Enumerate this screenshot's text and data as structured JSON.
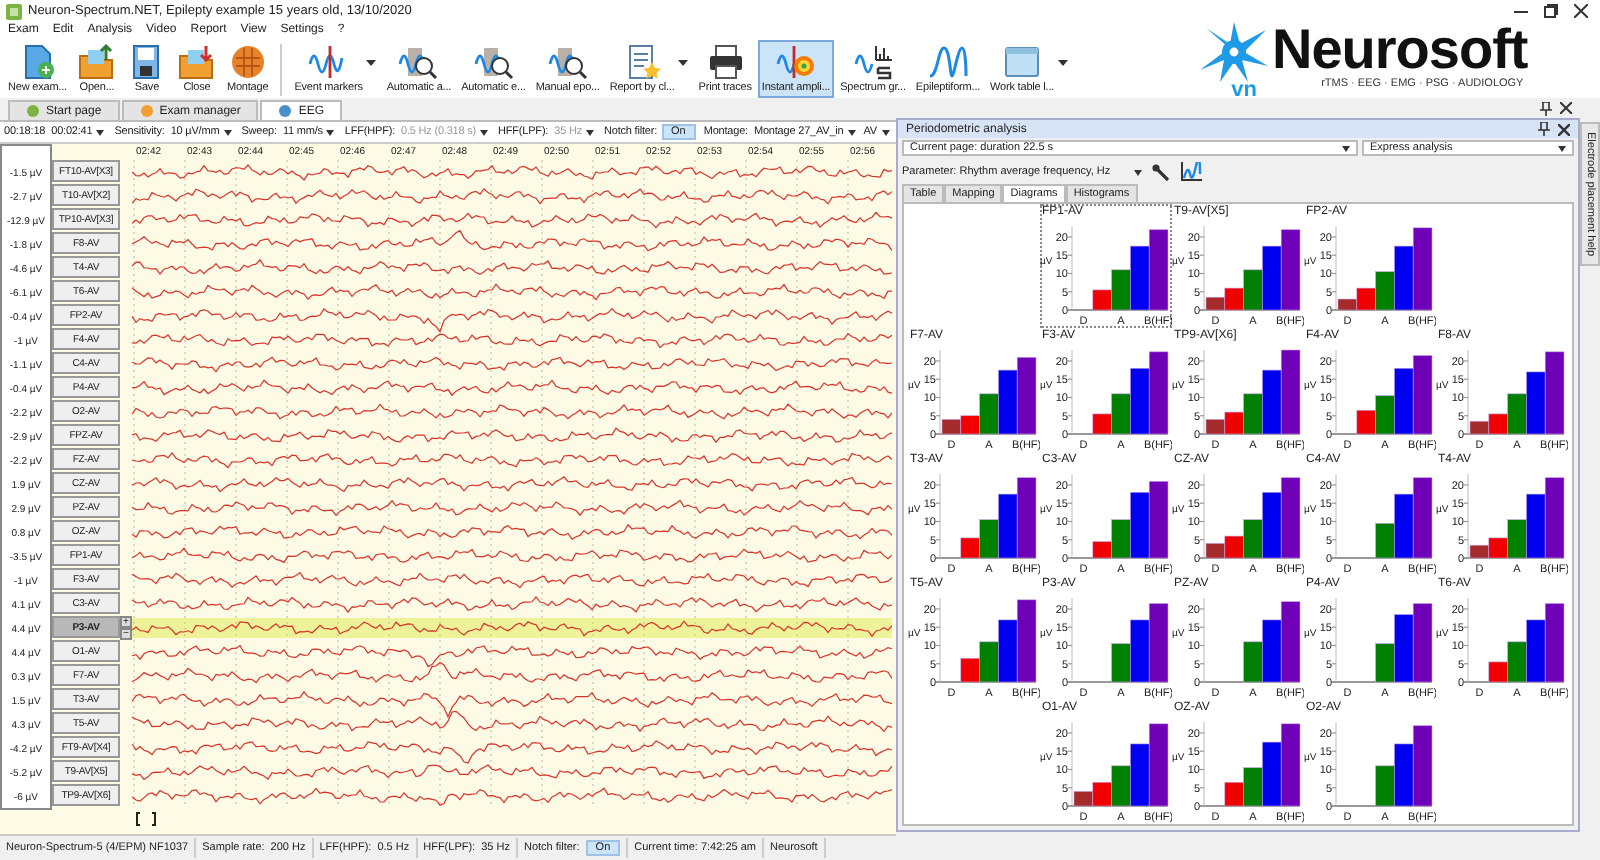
{
  "window": {
    "title": "Neuron-Spectrum.NET, Epilepty example 15 years old, 13/10/2020"
  },
  "menu": [
    "Exam",
    "Edit",
    "Analysis",
    "Video",
    "Report",
    "View",
    "Settings",
    "?"
  ],
  "toolbar": {
    "groups": [
      [
        {
          "label": "New exam...",
          "selected": false,
          "dropdown": false
        },
        {
          "label": "Open...",
          "selected": false,
          "dropdown": false
        },
        {
          "label": "Save",
          "selected": false,
          "dropdown": false
        },
        {
          "label": "Close",
          "selected": false,
          "dropdown": false
        },
        {
          "label": "Montage",
          "selected": false,
          "dropdown": false
        }
      ],
      [
        {
          "label": "Event markers",
          "selected": false,
          "dropdown": true
        },
        {
          "label": "Automatic a...",
          "selected": false,
          "dropdown": false
        },
        {
          "label": "Automatic e...",
          "selected": false,
          "dropdown": false
        },
        {
          "label": "Manual epo...",
          "selected": false,
          "dropdown": false
        },
        {
          "label": "Report by cl...",
          "selected": false,
          "dropdown": true
        },
        {
          "label": "Print traces",
          "selected": false,
          "dropdown": false
        },
        {
          "label": "Instant ampli...",
          "selected": true,
          "dropdown": false
        },
        {
          "label": "Spectrum gr...",
          "selected": false,
          "dropdown": false
        },
        {
          "label": "Epileptiform...",
          "selected": false,
          "dropdown": false
        },
        {
          "label": "Work table l...",
          "selected": false,
          "dropdown": true
        }
      ]
    ]
  },
  "logo": {
    "name": "Neurosoft",
    "suffix": "vn",
    "tagline": "rTMS · EEG · EMG · PSG · AUDIOLOGY"
  },
  "tabs": [
    {
      "label": "Start page",
      "selected": false
    },
    {
      "label": "Exam manager",
      "selected": false
    },
    {
      "label": "EEG",
      "selected": true
    }
  ],
  "eeg": {
    "params": [
      {
        "kind": "text",
        "value": "00:18:18"
      },
      {
        "kind": "dropdown",
        "value": "00:02:41",
        "disabled": false
      },
      {
        "kind": "dropdown",
        "label": "Sensitivity:",
        "value": "10 µV/mm",
        "disabled": false
      },
      {
        "kind": "dropdown",
        "label": "Sweep:",
        "value": "11 mm/s",
        "disabled": false
      },
      {
        "kind": "dropdown",
        "label": "LFF(HPF):",
        "value": "0.5 Hz (0.318 s)",
        "disabled": true
      },
      {
        "kind": "dropdown",
        "label": "HFF(LPF):",
        "value": "35 Hz",
        "disabled": true
      },
      {
        "kind": "toggle",
        "label": "Notch filter:",
        "value": "On",
        "on": true
      },
      {
        "kind": "dropdown",
        "label": "Montage:",
        "value": "Montage 27_AV_in",
        "disabled": false
      },
      {
        "kind": "dropdown",
        "value": "AV",
        "disabled": false
      }
    ],
    "times": [
      "02:42",
      "02:43",
      "02:44",
      "02:45",
      "02:46",
      "02:47",
      "02:48",
      "02:49",
      "02:50",
      "02:51",
      "02:52",
      "02:53",
      "02:54",
      "02:55",
      "02:56"
    ],
    "adjust_buttons": [
      "+",
      "−"
    ],
    "channels": [
      {
        "name": "FT10-AV[X3]",
        "reading": "-1.5 µV",
        "selected": false
      },
      {
        "name": "T10-AV[X2]",
        "reading": "-2.7 µV",
        "selected": false
      },
      {
        "name": "TP10-AV[X3]",
        "reading": "-12.9 µV",
        "selected": false
      },
      {
        "name": "F8-AV",
        "reading": "-1.8 µV",
        "selected": false
      },
      {
        "name": "T4-AV",
        "reading": "-4.6 µV",
        "selected": false
      },
      {
        "name": "T6-AV",
        "reading": "-6.1 µV",
        "selected": false
      },
      {
        "name": "FP2-AV",
        "reading": "-0.4 µV",
        "selected": false
      },
      {
        "name": "F4-AV",
        "reading": "-1 µV",
        "selected": false
      },
      {
        "name": "C4-AV",
        "reading": "-1.1 µV",
        "selected": false
      },
      {
        "name": "P4-AV",
        "reading": "-0.4 µV",
        "selected": false
      },
      {
        "name": "O2-AV",
        "reading": "-2.2 µV",
        "selected": false
      },
      {
        "name": "FPZ-AV",
        "reading": "-2.9 µV",
        "selected": false
      },
      {
        "name": "FZ-AV",
        "reading": "-2.2 µV",
        "selected": false
      },
      {
        "name": "CZ-AV",
        "reading": "1.9 µV",
        "selected": false
      },
      {
        "name": "PZ-AV",
        "reading": "2.9 µV",
        "selected": false
      },
      {
        "name": "OZ-AV",
        "reading": "0.8 µV",
        "selected": false
      },
      {
        "name": "FP1-AV",
        "reading": "-3.5 µV",
        "selected": false
      },
      {
        "name": "F3-AV",
        "reading": "-1 µV",
        "selected": false
      },
      {
        "name": "C3-AV",
        "reading": "4.1 µV",
        "selected": false
      },
      {
        "name": "P3-AV",
        "reading": "4.4 µV",
        "selected": true
      },
      {
        "name": "O1-AV",
        "reading": "4.4 µV",
        "selected": false
      },
      {
        "name": "F7-AV",
        "reading": "0.3 µV",
        "selected": false
      },
      {
        "name": "T3-AV",
        "reading": "1.5 µV",
        "selected": false
      },
      {
        "name": "T5-AV",
        "reading": "4.3 µV",
        "selected": false
      },
      {
        "name": "FT9-AV[X4]",
        "reading": "-4.2 µV",
        "selected": false
      },
      {
        "name": "T9-AV[X5]",
        "reading": "-5.2 µV",
        "selected": false
      },
      {
        "name": "TP9-AV[X6]",
        "reading": "-6 µV",
        "selected": false
      }
    ]
  },
  "status_bar": [
    {
      "kind": "text",
      "value": "Neuron-Spectrum-5 (4/EPM) NF1037"
    },
    {
      "kind": "text",
      "label": "Sample rate:",
      "value": "200 Hz"
    },
    {
      "kind": "text",
      "label": "LFF(HPF):",
      "value": "0.5 Hz"
    },
    {
      "kind": "text",
      "label": "HFF(LPF):",
      "value": "35 Hz"
    },
    {
      "kind": "toggle",
      "label": "Notch filter:",
      "value": "On",
      "on": true
    },
    {
      "kind": "text",
      "value": "Current time: 7:42:25 am"
    },
    {
      "kind": "text",
      "value": "Neurosoft"
    }
  ],
  "panel": {
    "title": "Periodometric analysis",
    "page_select": "Current page: duration 22.5 s",
    "mode_select": "Express analysis",
    "parameter": "Parameter: Rhythm average frequency, Hz",
    "tabs": [
      {
        "label": "Table",
        "selected": false
      },
      {
        "label": "Mapping",
        "selected": false
      },
      {
        "label": "Diagrams",
        "selected": true
      },
      {
        "label": "Histograms",
        "selected": false
      }
    ],
    "diagrams": {
      "rows": [
        [
          {
            "selected": true,
            "chart_data": {
              "type": "bar",
              "title": "FP1-AV",
              "ylabel": "µV",
              "categories": [
                "D",
                null,
                "A",
                null,
                "B(HF)"
              ],
              "values": [
                0,
                5.5,
                11,
                17.5,
                22
              ],
              "yticks": [
                0,
                5,
                10,
                15,
                20
              ],
              "ylim": [
                0,
                23
              ]
            }
          },
          {
            "selected": false,
            "chart_data": {
              "type": "bar",
              "title": "T9-AV[X5]",
              "ylabel": "µV",
              "categories": [
                "D",
                null,
                "A",
                null,
                "B(HF)"
              ],
              "values": [
                3.5,
                6,
                11,
                17.5,
                22
              ],
              "yticks": [
                0,
                5,
                10,
                15,
                20
              ],
              "ylim": [
                0,
                23
              ]
            }
          },
          {
            "selected": false,
            "chart_data": {
              "type": "bar",
              "title": "FP2-AV",
              "ylabel": "µV",
              "categories": [
                "D",
                null,
                "A",
                null,
                "B(HF)"
              ],
              "values": [
                3,
                6,
                10.5,
                17.5,
                22.5
              ],
              "yticks": [
                0,
                5,
                10,
                15,
                20
              ],
              "ylim": [
                0,
                23
              ]
            }
          }
        ],
        [
          {
            "selected": false,
            "chart_data": {
              "type": "bar",
              "title": "F7-AV",
              "ylabel": "µV",
              "categories": [
                "D",
                null,
                "A",
                null,
                "B(HF)"
              ],
              "values": [
                4,
                5,
                11,
                17.5,
                21
              ],
              "yticks": [
                0,
                5,
                10,
                15,
                20
              ],
              "ylim": [
                0,
                23
              ]
            }
          },
          {
            "selected": false,
            "chart_data": {
              "type": "bar",
              "title": "F3-AV",
              "ylabel": "µV",
              "categories": [
                "D",
                null,
                "A",
                null,
                "B(HF)"
              ],
              "values": [
                0,
                5.5,
                11,
                18,
                22.5
              ],
              "yticks": [
                0,
                5,
                10,
                15,
                20
              ],
              "ylim": [
                0,
                23
              ]
            }
          },
          {
            "selected": false,
            "chart_data": {
              "type": "bar",
              "title": "TP9-AV[X6]",
              "ylabel": "µV",
              "categories": [
                "D",
                null,
                "A",
                null,
                "B(HF)"
              ],
              "values": [
                4,
                6,
                11,
                17.5,
                23
              ],
              "yticks": [
                0,
                5,
                10,
                15,
                20
              ],
              "ylim": [
                0,
                23
              ]
            }
          },
          {
            "selected": false,
            "chart_data": {
              "type": "bar",
              "title": "F4-AV",
              "ylabel": "µV",
              "categories": [
                "D",
                null,
                "A",
                null,
                "B(HF)"
              ],
              "values": [
                0,
                6.5,
                10.5,
                18,
                21.5
              ],
              "yticks": [
                0,
                5,
                10,
                15,
                20
              ],
              "ylim": [
                0,
                23
              ]
            }
          },
          {
            "selected": false,
            "chart_data": {
              "type": "bar",
              "title": "F8-AV",
              "ylabel": "µV",
              "categories": [
                "D",
                null,
                "A",
                null,
                "B(HF)"
              ],
              "values": [
                3.5,
                5.5,
                11,
                17,
                22.5
              ],
              "yticks": [
                0,
                5,
                10,
                15,
                20
              ],
              "ylim": [
                0,
                23
              ]
            }
          }
        ],
        [
          {
            "selected": false,
            "chart_data": {
              "type": "bar",
              "title": "T3-AV",
              "ylabel": "µV",
              "categories": [
                "D",
                null,
                "A",
                null,
                "B(HF)"
              ],
              "values": [
                0,
                5.5,
                10.5,
                17.5,
                22
              ],
              "yticks": [
                0,
                5,
                10,
                15,
                20
              ],
              "ylim": [
                0,
                23
              ]
            }
          },
          {
            "selected": false,
            "chart_data": {
              "type": "bar",
              "title": "C3-AV",
              "ylabel": "µV",
              "categories": [
                "D",
                null,
                "A",
                null,
                "B(HF)"
              ],
              "values": [
                0,
                4.5,
                10.5,
                18,
                21
              ],
              "yticks": [
                0,
                5,
                10,
                15,
                20
              ],
              "ylim": [
                0,
                23
              ]
            }
          },
          {
            "selected": false,
            "chart_data": {
              "type": "bar",
              "title": "CZ-AV",
              "ylabel": "µV",
              "categories": [
                "D",
                null,
                "A",
                null,
                "B(HF)"
              ],
              "values": [
                4,
                6,
                10.5,
                18,
                22
              ],
              "yticks": [
                0,
                5,
                10,
                15,
                20
              ],
              "ylim": [
                0,
                23
              ]
            }
          },
          {
            "selected": false,
            "chart_data": {
              "type": "bar",
              "title": "C4-AV",
              "ylabel": "µV",
              "categories": [
                "D",
                null,
                "A",
                null,
                "B(HF)"
              ],
              "values": [
                0,
                0,
                9.5,
                17.5,
                22
              ],
              "yticks": [
                0,
                5,
                10,
                15,
                20
              ],
              "ylim": [
                0,
                23
              ]
            }
          },
          {
            "selected": false,
            "chart_data": {
              "type": "bar",
              "title": "T4-AV",
              "ylabel": "µV",
              "categories": [
                "D",
                null,
                "A",
                null,
                "B(HF)"
              ],
              "values": [
                3.5,
                5.5,
                10.5,
                17.5,
                22
              ],
              "yticks": [
                0,
                5,
                10,
                15,
                20
              ],
              "ylim": [
                0,
                23
              ]
            }
          }
        ],
        [
          {
            "selected": false,
            "chart_data": {
              "type": "bar",
              "title": "T5-AV",
              "ylabel": "µV",
              "categories": [
                "D",
                null,
                "A",
                null,
                "B(HF)"
              ],
              "values": [
                0,
                6.5,
                11,
                17,
                22.5
              ],
              "yticks": [
                0,
                5,
                10,
                15,
                20
              ],
              "ylim": [
                0,
                23
              ]
            }
          },
          {
            "selected": false,
            "chart_data": {
              "type": "bar",
              "title": "P3-AV",
              "ylabel": "µV",
              "categories": [
                "D",
                null,
                "A",
                null,
                "B(HF)"
              ],
              "values": [
                0,
                0,
                10.5,
                17,
                21.5
              ],
              "yticks": [
                0,
                5,
                10,
                15,
                20
              ],
              "ylim": [
                0,
                23
              ]
            }
          },
          {
            "selected": false,
            "chart_data": {
              "type": "bar",
              "title": "PZ-AV",
              "ylabel": "µV",
              "categories": [
                "D",
                null,
                "A",
                null,
                "B(HF)"
              ],
              "values": [
                0,
                0,
                11,
                17,
                22
              ],
              "yticks": [
                0,
                5,
                10,
                15,
                20
              ],
              "ylim": [
                0,
                23
              ]
            }
          },
          {
            "selected": false,
            "chart_data": {
              "type": "bar",
              "title": "P4-AV",
              "ylabel": "µV",
              "categories": [
                "D",
                null,
                "A",
                null,
                "B(HF)"
              ],
              "values": [
                0,
                0,
                10.5,
                18.5,
                21.5
              ],
              "yticks": [
                0,
                5,
                10,
                15,
                20
              ],
              "ylim": [
                0,
                23
              ]
            }
          },
          {
            "selected": false,
            "chart_data": {
              "type": "bar",
              "title": "T6-AV",
              "ylabel": "µV",
              "categories": [
                "D",
                null,
                "A",
                null,
                "B(HF)"
              ],
              "values": [
                0,
                5.5,
                11,
                17,
                21.5
              ],
              "yticks": [
                0,
                5,
                10,
                15,
                20
              ],
              "ylim": [
                0,
                23
              ]
            }
          }
        ],
        [
          {
            "selected": false,
            "chart_data": {
              "type": "bar",
              "title": "O1-AV",
              "ylabel": "µV",
              "categories": [
                "D",
                null,
                "A",
                null,
                "B(HF)"
              ],
              "values": [
                4,
                6.5,
                11,
                17,
                22.5
              ],
              "yticks": [
                0,
                5,
                10,
                15,
                20
              ],
              "ylim": [
                0,
                23
              ]
            }
          },
          {
            "selected": false,
            "chart_data": {
              "type": "bar",
              "title": "OZ-AV",
              "ylabel": "µV",
              "categories": [
                "D",
                null,
                "A",
                null,
                "B(HF)"
              ],
              "values": [
                0,
                6.5,
                10.5,
                17.5,
                22.5
              ],
              "yticks": [
                0,
                5,
                10,
                15,
                20
              ],
              "ylim": [
                0,
                23
              ]
            }
          },
          {
            "selected": false,
            "chart_data": {
              "type": "bar",
              "title": "O2-AV",
              "ylabel": "µV",
              "categories": [
                "D",
                null,
                "A",
                null,
                "B(HF)"
              ],
              "values": [
                0,
                0,
                11,
                17,
                22
              ],
              "yticks": [
                0,
                5,
                10,
                15,
                20
              ],
              "ylim": [
                0,
                23
              ]
            }
          }
        ]
      ]
    }
  },
  "side_tab": "Electrode placement help"
}
